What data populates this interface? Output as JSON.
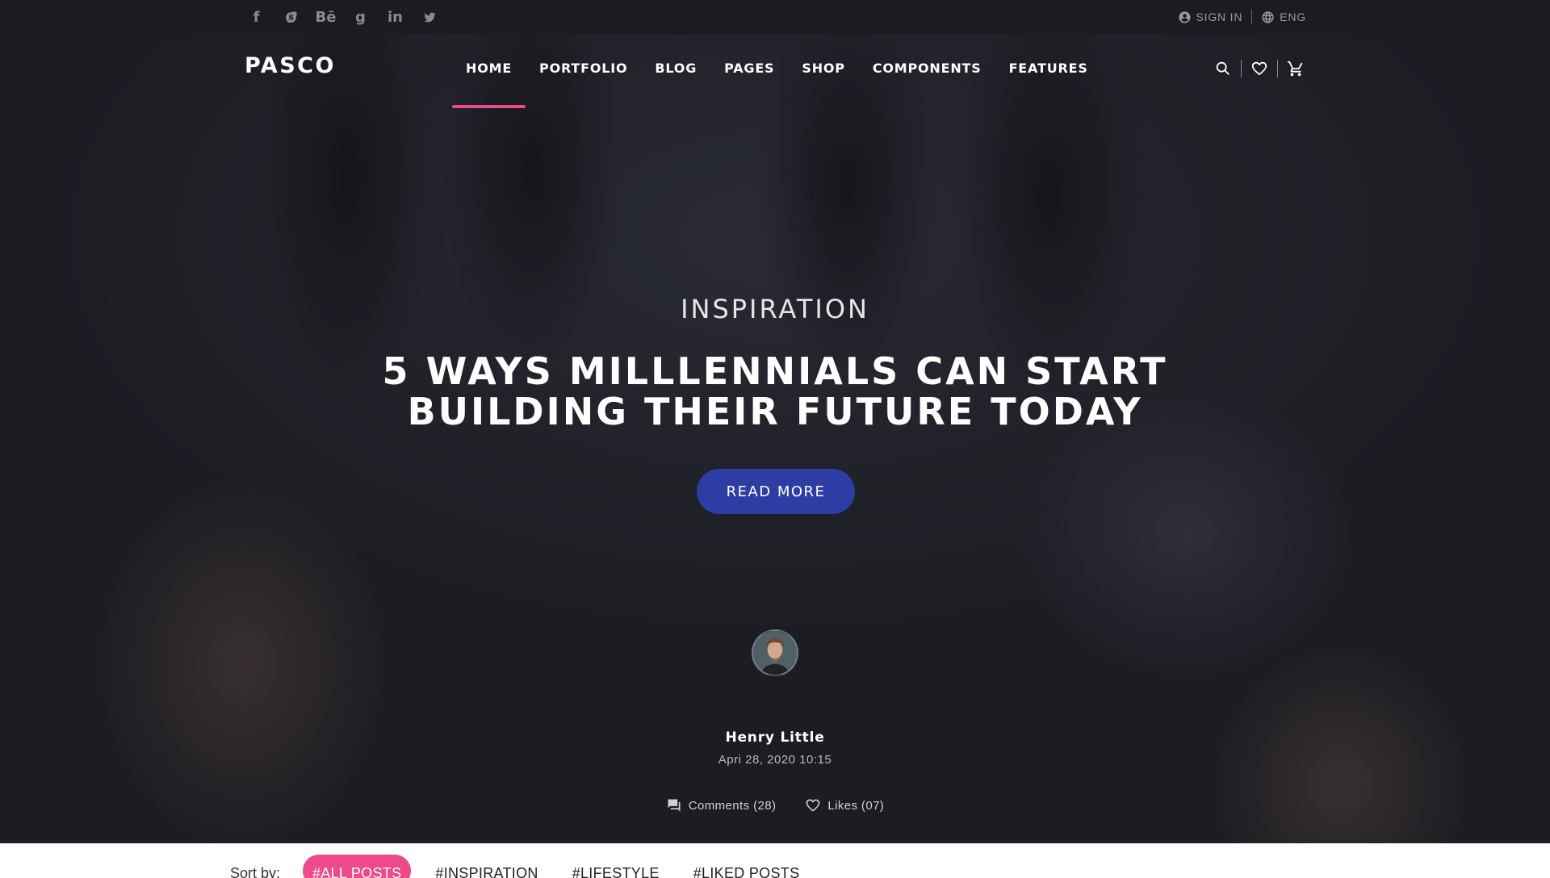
{
  "topbar": {
    "social": [
      {
        "icon": "facebook-icon",
        "glyph": "f"
      },
      {
        "icon": "skype-icon",
        "glyph": "S"
      },
      {
        "icon": "behance-icon",
        "glyph": "Bē"
      },
      {
        "icon": "google-icon",
        "glyph": "g"
      },
      {
        "icon": "linkedin-icon",
        "glyph": "in"
      },
      {
        "icon": "twitter-icon",
        "glyph": "t"
      }
    ],
    "sign_in": "SIGN IN",
    "language": "ENG"
  },
  "header": {
    "logo": "PASCO",
    "nav": [
      "HOME",
      "PORTFOLIO",
      "BLOG",
      "PAGES",
      "SHOP",
      "COMPONENTS",
      "FEATURES"
    ],
    "active_nav": "HOME"
  },
  "hero": {
    "category": "INSPIRATION",
    "title_line1": "5 WAYS MILLLENNIALS CAN START",
    "title_line2": "BUILDING THEIR FUTURE TODAY",
    "read_more": "READ MORE",
    "author": "Henry Little",
    "date": "Apri 28, 2020 10:15",
    "comments": "Comments (28)",
    "likes": "Likes (07)"
  },
  "sort": {
    "label": "Sort by:",
    "chips": [
      "#ALL POSTS",
      "#INSPIRATION",
      "#LIFESTYLE",
      "#LIKED POSTS"
    ],
    "active": "#ALL POSTS"
  },
  "colors": {
    "accent": "#ec4a8a",
    "button": "#2e3da4",
    "topbar": "#1b1b20"
  }
}
